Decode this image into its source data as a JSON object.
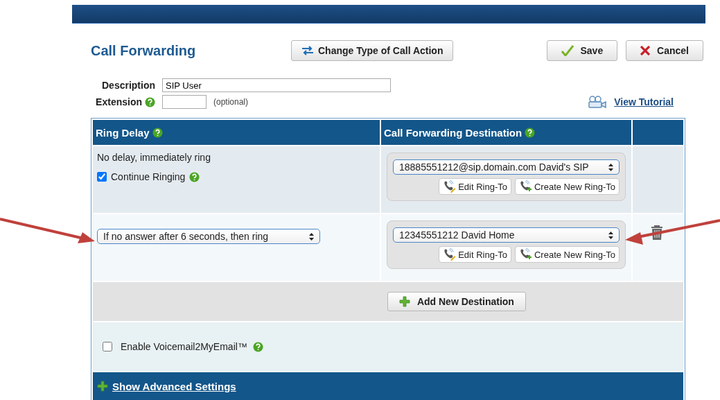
{
  "title": "Call Forwarding",
  "header_buttons": [
    {
      "kind": "change",
      "label": "Change Type of Call Action"
    },
    {
      "kind": "save",
      "label": "Save"
    },
    {
      "kind": "cancel",
      "label": "Cancel"
    }
  ],
  "description": {
    "label": "Description",
    "value": "SIP User"
  },
  "extension": {
    "label": "Extension",
    "hint": "(optional)"
  },
  "tutorial_link": "View Tutorial",
  "table": {
    "columns": [
      "Ring Delay",
      "Call Forwarding Destination"
    ],
    "rows": [
      {
        "kind": "immediate",
        "delay_text": "No delay, immediately ring",
        "continue_label": "Continue Ringing",
        "checked": true,
        "destination": "18885551212@sip.domain.com David's SIP",
        "edit_label": "Edit Ring-To",
        "create_label": "Create New Ring-To",
        "deletable": false
      },
      {
        "kind": "delay",
        "delay_text": "If no answer after 6 seconds, then ring",
        "destination": "12345551212 David Home",
        "edit_label": "Edit Ring-To",
        "create_label": "Create New Ring-To",
        "deletable": true
      }
    ],
    "add_button": "Add New Destination"
  },
  "voicemail": {
    "label": "Enable Voicemail2MyEmail™",
    "checked": false
  },
  "advanced_link": "Show Advanced Settings"
}
